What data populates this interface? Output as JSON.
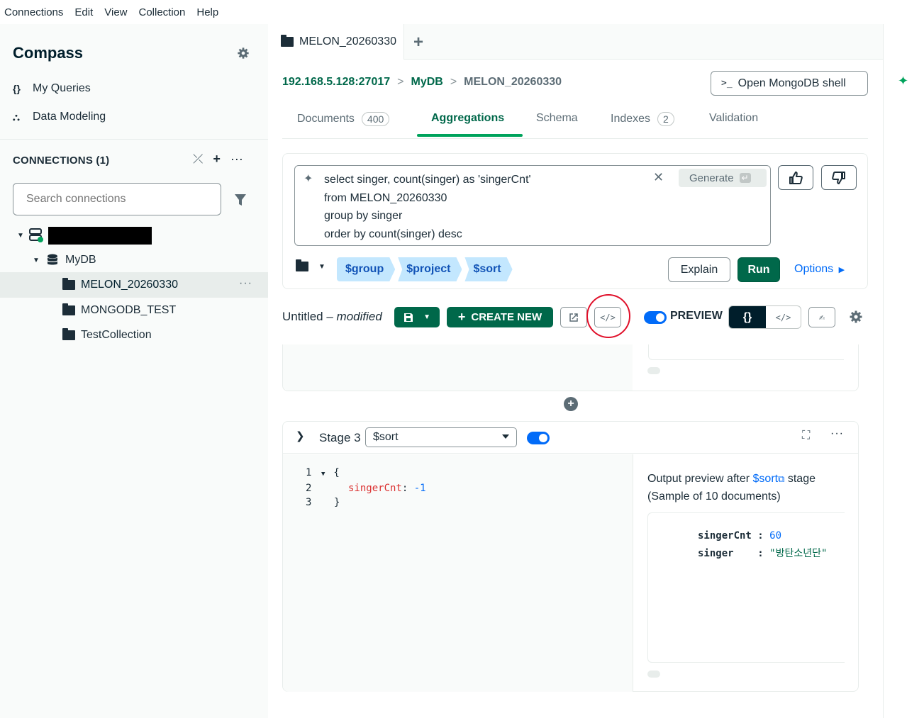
{
  "menubar": [
    "Connections",
    "Edit",
    "View",
    "Collection",
    "Help"
  ],
  "sidebar": {
    "title": "Compass",
    "nav": [
      {
        "icon": "curly-braces-icon",
        "glyph": "{}",
        "label": "My Queries"
      },
      {
        "icon": "data-modeling-icon",
        "glyph": "⛬",
        "label": "Data Modeling"
      }
    ],
    "connections_header": "CONNECTIONS (1)",
    "search_placeholder": "Search connections",
    "tree": {
      "database": "MyDB",
      "collections": [
        "MELON_20260330",
        "MONGODB_TEST",
        "TestCollection"
      ]
    }
  },
  "tab": {
    "title": "MELON_20260330"
  },
  "breadcrumb": {
    "host": "192.168.5.128:27017",
    "db": "MyDB",
    "collection": "MELON_20260330"
  },
  "shell_button": {
    "prompt": ">_",
    "label": "Open MongoDB shell"
  },
  "subtabs": {
    "documents": {
      "label": "Documents",
      "count": "400"
    },
    "aggregations": {
      "label": "Aggregations"
    },
    "schema": {
      "label": "Schema"
    },
    "indexes": {
      "label": "Indexes",
      "count": "2"
    },
    "validation": {
      "label": "Validation"
    }
  },
  "ai_query": {
    "lines": [
      "select singer, count(singer) as 'singerCnt'",
      "from MELON_20260330",
      "group by singer",
      "order by count(singer) desc"
    ],
    "generate_label": "Generate"
  },
  "pipeline": {
    "stages": [
      "$group",
      "$project",
      "$sort"
    ],
    "explain_label": "Explain",
    "run_label": "Run",
    "options_label": "Options"
  },
  "toolbar": {
    "name": "Untitled",
    "modified": "modified",
    "create_new_label": "CREATE NEW",
    "preview_label": "PREVIEW"
  },
  "stage3": {
    "label": "Stage 3",
    "operator": "$sort",
    "code": {
      "line1": "1",
      "line2": "2",
      "line3": "3",
      "open": "{",
      "key": "singerCnt",
      "value": "-1",
      "close": "}"
    },
    "output_prefix": "Output preview after",
    "output_link": "$sort",
    "output_suffix": "stage",
    "sample": "(Sample of 10 documents)",
    "doc": {
      "k1": "singerCnt",
      "v1": "60",
      "k2": "singer",
      "v2": "\"방탄소년단\""
    }
  },
  "colors": {
    "accent_green": "#00684a",
    "tab_underline": "#00a35c",
    "link_blue": "#016bf8",
    "chip_bg": "#c3e7fe",
    "highlight_red": "#e0102a"
  }
}
